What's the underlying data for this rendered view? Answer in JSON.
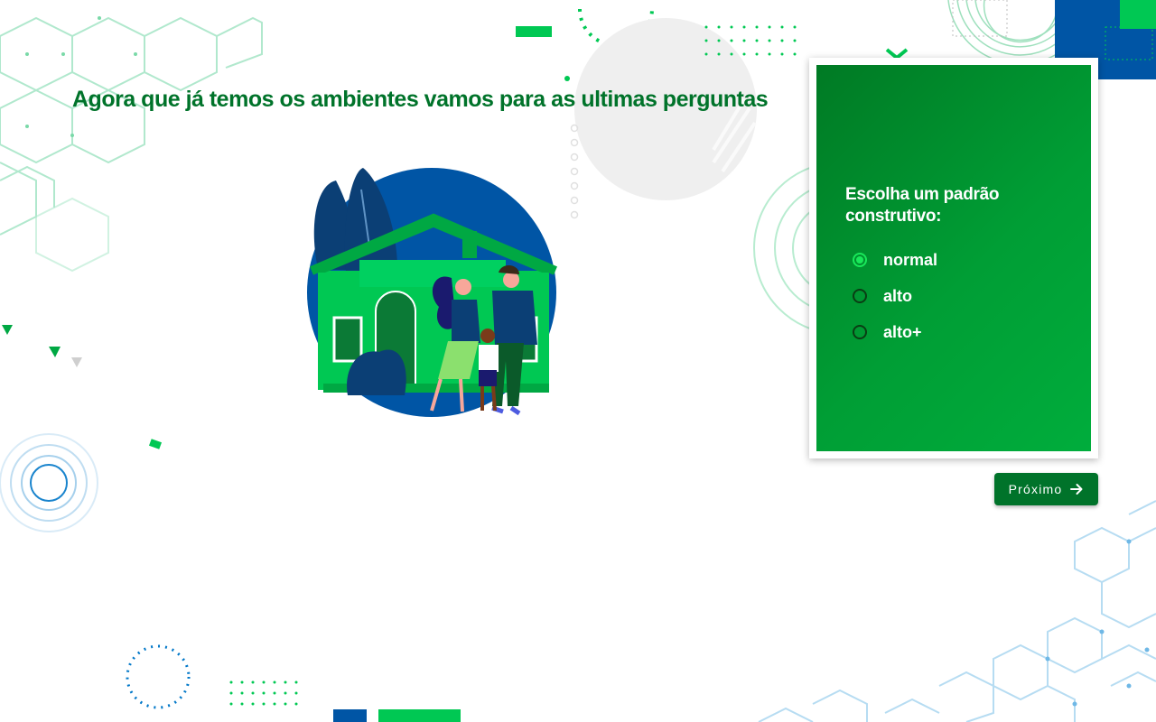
{
  "page": {
    "title": "Agora que já temos os ambientes vamos para as ultimas perguntas"
  },
  "card": {
    "question": "Escolha um padrão construtivo:",
    "options": [
      {
        "label": "normal",
        "selected": true
      },
      {
        "label": "alto",
        "selected": false
      },
      {
        "label": "alto+",
        "selected": false
      }
    ]
  },
  "actions": {
    "next_label": "Próximo",
    "next_icon": "arrow-right-icon"
  },
  "colors": {
    "primary_green": "#00732a",
    "bright_green": "#19e85a",
    "accent_blue": "#0055a5",
    "light_green": "#00c853"
  }
}
